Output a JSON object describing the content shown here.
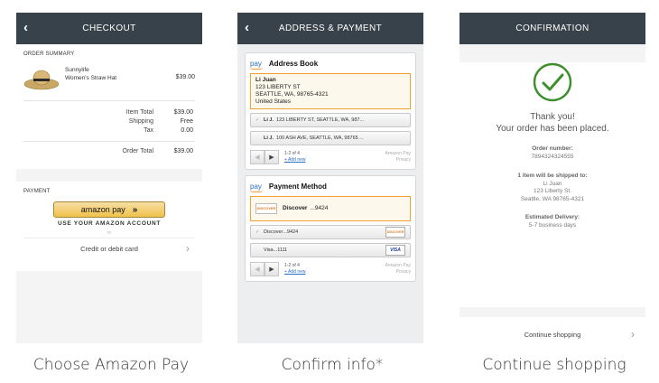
{
  "screens": {
    "checkout": {
      "title": "CHECKOUT",
      "order_summary_label": "ORDER SUMMARY",
      "product": {
        "brand": "Sunnylife",
        "name": "Women's Straw Hat",
        "price": "$39.00"
      },
      "totals": [
        {
          "label": "Item Total",
          "value": "$39.00"
        },
        {
          "label": "Shipping",
          "value": "Free"
        },
        {
          "label": "Tax",
          "value": "0.00"
        }
      ],
      "order_total": {
        "label": "Order Total",
        "value": "$39.00"
      },
      "payment_label": "PAYMENT",
      "amazon_pay_button": "amazon pay",
      "amazon_pay_chevron": "»",
      "amazon_pay_sub": "USE YOUR AMAZON ACCOUNT",
      "or_text": "or",
      "card_option": "Credit or debit card",
      "caption": "Choose Amazon Pay"
    },
    "address_payment": {
      "title": "ADDRESS & PAYMENT",
      "pay_logo": "pay",
      "address_book": {
        "title": "Address Book",
        "selected": {
          "name": "Li Juan",
          "line1": "123 LIBERTY ST",
          "line2": "SEATTLE, WA, 98765-4321",
          "line3": "United States"
        },
        "options": [
          {
            "name": "Li J.",
            "address": "123 LIBERTY ST, SEATTLE, WA, 987...",
            "checked": true
          },
          {
            "name": "Li J.",
            "address": "100 ASH AVE, SEATTLE, WA, 98765 ...",
            "checked": false
          }
        ],
        "pager": "1-2 of 4",
        "add_link": "+ Add new",
        "brand_note_1": "Amazon Pay",
        "brand_note_2": "Privacy"
      },
      "payment_method": {
        "title": "Payment Method",
        "selected": {
          "card": "Discover",
          "digits": "...9424"
        },
        "options": [
          {
            "card": "Discover",
            "digits": "...9424",
            "icon": "DISCOVER",
            "checked": true
          },
          {
            "card": "Visa",
            "digits": "...1111",
            "icon": "VISA",
            "checked": false
          }
        ],
        "pager": "1-2 of 4",
        "add_link": "+ Add new",
        "brand_note_1": "Amazon Pay",
        "brand_note_2": "Privacy"
      },
      "caption": "Confirm info*"
    },
    "confirmation": {
      "title": "CONFIRMATION",
      "thanks_line1": "Thank you!",
      "thanks_line2": "Your order has been placed.",
      "order_number_label": "Order number:",
      "order_number": "7894324324555",
      "ship_label": "1 item will be shipped to:",
      "ship_name": "Li Juan",
      "ship_line1": "123 Liberty St.",
      "ship_line2": "Seattle, WA 98765-4321",
      "delivery_label": "Estimated Delivery:",
      "delivery_value": "5-7 business days",
      "continue": "Continue shopping",
      "caption": "Continue shopping"
    }
  },
  "colors": {
    "header_bg": "#37424a",
    "amazon_orange": "#f0a030",
    "check_green": "#3f8f2e",
    "link_blue": "#2a6fbf"
  }
}
